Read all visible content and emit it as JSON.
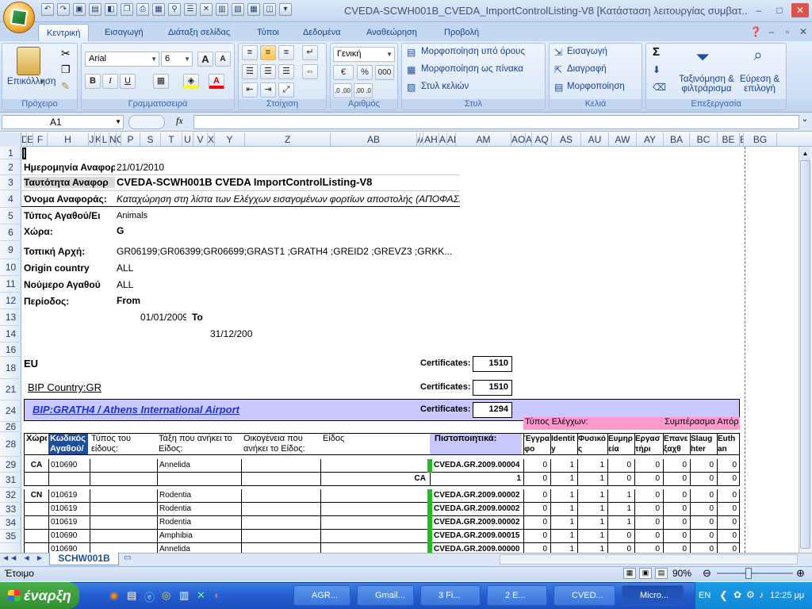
{
  "window": {
    "title": "CVEDA-SCWH001B_CVEDA_ImportControlListing-V8  [Κατάσταση λειτουργίας συμβατ... M",
    "controls": [
      "–",
      "□",
      "✕"
    ]
  },
  "ribbon_tabs": [
    "Κεντρική",
    "Εισαγωγή",
    "Διάταξη σελίδας",
    "Τύποι",
    "Δεδομένα",
    "Αναθεώρηση",
    "Προβολή"
  ],
  "ribbon": {
    "clipboard": {
      "label": "Πρόχειρο",
      "paste": "Επικόλληση"
    },
    "font": {
      "label": "Γραμματοσειρά",
      "font_name": "Arial",
      "font_size": "6",
      "bold": "B",
      "italic": "I",
      "underline": "U",
      "grow": "A",
      "shrink": "A"
    },
    "alignment": {
      "label": "Στοίχιση"
    },
    "number": {
      "label": "Αριθμός",
      "format": "Γενική",
      "percent": "%",
      "thousands": "000",
      "inc_dec": ",0 ,00",
      "dec_dec": ",00 ,0"
    },
    "styles": {
      "label": "Στυλ",
      "conditional": "Μορφοποίηση υπό όρους",
      "as_table": "Μορφοποίηση ως πίνακα",
      "cell_styles": "Στυλ κελιών"
    },
    "cells": {
      "label": "Κελιά",
      "insert": "Εισαγωγή",
      "delete": "Διαγραφή",
      "format": "Μορφοποίηση"
    },
    "editing": {
      "label": "Επεξεργασία",
      "sigma": "Σ",
      "sort_line1": "Ταξινόμηση &",
      "sort_line2": "φιλτράρισμα",
      "find_line1": "Εύρεση &",
      "find_line2": "επιλογή"
    }
  },
  "formula": {
    "namebox": "A1",
    "fx": "fx",
    "value": ""
  },
  "columns": [
    "D",
    "E",
    "F",
    "H",
    "J",
    "K",
    "L",
    "N",
    "O",
    "P",
    "S",
    "T",
    "U",
    "V",
    "X",
    "Y",
    "Z",
    "AB",
    "AD",
    "AE",
    "AH",
    "AI",
    "AK",
    "AM",
    "AO",
    "AP",
    "AQ",
    "AS",
    "AU",
    "AW",
    "AY",
    "BA",
    "BC",
    "BE",
    "BF",
    "BG"
  ],
  "rows": [
    "1",
    "2",
    "3",
    "4",
    "5",
    "6",
    "9",
    "10",
    "11",
    "12",
    "13",
    "14",
    "16",
    "18",
    "21",
    "24",
    "26",
    "28",
    "29",
    "31",
    "32",
    "33",
    "34",
    "35"
  ],
  "report": {
    "date_label": "Ημερομηνία Αναφορ",
    "date_value": "21/01/2010",
    "id_label": "Ταυτότητα Αναφορ",
    "id_value": "CVEDA-SCWH001B CVEDA ImportControlListing-V8",
    "name_label": "Όνομα Αναφοράς:",
    "name_value": "Καταχώρηση στη λίστα των Ελέγχων εισαγομένων φορτίων αποστολής (ΑΠΟΦΑΣΙ",
    "type_label": "Τύπος Αγαθού/Ει",
    "type_value": "Animals",
    "country_label": "Χώρα:",
    "country_value": "G",
    "authority_label": "Τοπική Αρχή:",
    "authority_value": "GR06199;GR06399;GR06699;GRAST1 ;GRATH4 ;GREID2 ;GREVZ3 ;GRKK...",
    "origin_label": "Origin country",
    "origin_value": "ALL",
    "product_label": "Νούμερο Αγαθού",
    "product_value": "ALL",
    "period_label": "Περίοδος:",
    "from_label": "From",
    "from_value": "01/01/2009",
    "to_label": "To",
    "to_value": "31/12/200"
  },
  "sections": {
    "eu_label": "EU",
    "certificates_label": "Certificates:",
    "eu_certificates": "1510",
    "bip_country": "BIP Country:GR",
    "bip_country_certificates": "1510",
    "bip": "BIP:GRATH4  / Athens International Airport",
    "bip_certificates": "1294",
    "controls_type": "Τύπος Ελέγχων:",
    "conclusion": "Συμπέρασμα Απόρ"
  },
  "table_headers": {
    "country": "Χώρα",
    "code": "Κωδικός Αγαθού/",
    "type": "Τύπος του είδους:",
    "class": "Τάξη που ανήκει το Είδος:",
    "family": "Οικογένεια που ανήκει το Είδος:",
    "species": "Είδος",
    "certificates": "Πιστοποιητικά:",
    "documentary": "Έγγραφο",
    "identity": "Identity",
    "physical": "Φυσικός",
    "compliant": "Ευμηρεία",
    "labs": "Εργαστήρι",
    "reexport": "Επανεξαχθ",
    "slaughter": "Slaughter",
    "euthan": "Euthan"
  },
  "table_rows": [
    {
      "row": "28",
      "country": "CA",
      "code": "010690",
      "cls": "Annelida",
      "cert": "CVEDA.GR.2009.00004",
      "v": [
        "0",
        "1",
        "1",
        "0",
        "0",
        "0",
        "0",
        "0"
      ]
    },
    {
      "row": "29",
      "country": "",
      "code": "",
      "cls": "",
      "subtotal": "CA",
      "cert": "1",
      "v": [
        "0",
        "1",
        "1",
        "0",
        "0",
        "0",
        "0",
        "0"
      ]
    },
    {
      "row": "31",
      "country": "CN",
      "code": "010619",
      "cls": "Rodentia",
      "cert": "CVEDA.GR.2009.00002",
      "v": [
        "0",
        "1",
        "1",
        "1",
        "0",
        "0",
        "0",
        "0"
      ]
    },
    {
      "row": "32",
      "country": "",
      "code": "010619",
      "cls": "Rodentia",
      "cert": "CVEDA.GR.2009.00002",
      "v": [
        "0",
        "1",
        "1",
        "1",
        "0",
        "0",
        "0",
        "0"
      ]
    },
    {
      "row": "33",
      "country": "",
      "code": "010619",
      "cls": "Rodentia",
      "cert": "CVEDA.GR.2009.00002",
      "v": [
        "0",
        "1",
        "1",
        "1",
        "0",
        "0",
        "0",
        "0"
      ]
    },
    {
      "row": "34",
      "country": "",
      "code": "010690",
      "cls": "Amphibia",
      "cert": "CVEDA.GR.2009.00015",
      "v": [
        "0",
        "1",
        "1",
        "0",
        "0",
        "0",
        "0",
        "0"
      ]
    },
    {
      "row": "35",
      "country": "",
      "code": "010690",
      "cls": "Annelida",
      "cert": "CVEDA.GR.2009.00000",
      "v": [
        "0",
        "1",
        "1",
        "0",
        "0",
        "0",
        "0",
        "0"
      ]
    }
  ],
  "sheet_tab": "SCHW001B",
  "status": {
    "ready": "Έτοιμο",
    "zoom": "90%"
  },
  "taskbar": {
    "start": "έναρξη",
    "tasks": [
      "AGR...",
      "Gmail...",
      "3 Fi...",
      "2 E...",
      "CVED...",
      "Micro..."
    ],
    "lang": "EN",
    "clock": "12:25 μμ"
  },
  "colors": {
    "accent": "#1f4e9b",
    "bip_band": "#c8c8ff",
    "pink_header": "#ff99cc",
    "green_marker": "#22bb22",
    "blue_header": "#1f4e9b"
  }
}
